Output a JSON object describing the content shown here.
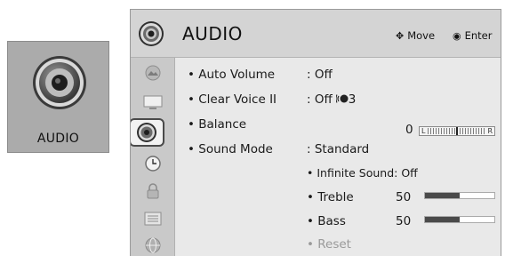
{
  "tile": {
    "label": "AUDIO",
    "icon": "speaker-icon"
  },
  "header": {
    "title": "AUDIO",
    "move_label": "Move",
    "enter_label": "Enter",
    "move_icon": "four-way-arrow-icon",
    "enter_icon": "ok-button-icon"
  },
  "rail": {
    "items": [
      {
        "icon": "picture-icon"
      },
      {
        "icon": "screen-icon"
      },
      {
        "icon": "speaker-icon",
        "selected": true
      },
      {
        "icon": "clock-icon"
      },
      {
        "icon": "lock-icon"
      },
      {
        "icon": "options-icon"
      },
      {
        "icon": "network-icon"
      }
    ]
  },
  "menu": {
    "auto_volume": {
      "label": "• Auto Volume",
      "value": ": Off"
    },
    "clear_voice": {
      "label": "• Clear Voice II",
      "value": ": Off",
      "level": "3",
      "icon": "voice-icon"
    },
    "balance": {
      "label": "• Balance",
      "value": "0",
      "left": "L",
      "right": "R",
      "position": 0
    },
    "sound_mode": {
      "label": "• Sound Mode",
      "value": ": Standard"
    },
    "infinite_sound": {
      "label": "• Infinite Sound",
      "value": ": Off"
    },
    "treble": {
      "label": "• Treble",
      "value": "50",
      "level": 0.5
    },
    "bass": {
      "label": "• Bass",
      "value": "50",
      "level": 0.5
    },
    "reset": {
      "label": "• Reset"
    }
  }
}
